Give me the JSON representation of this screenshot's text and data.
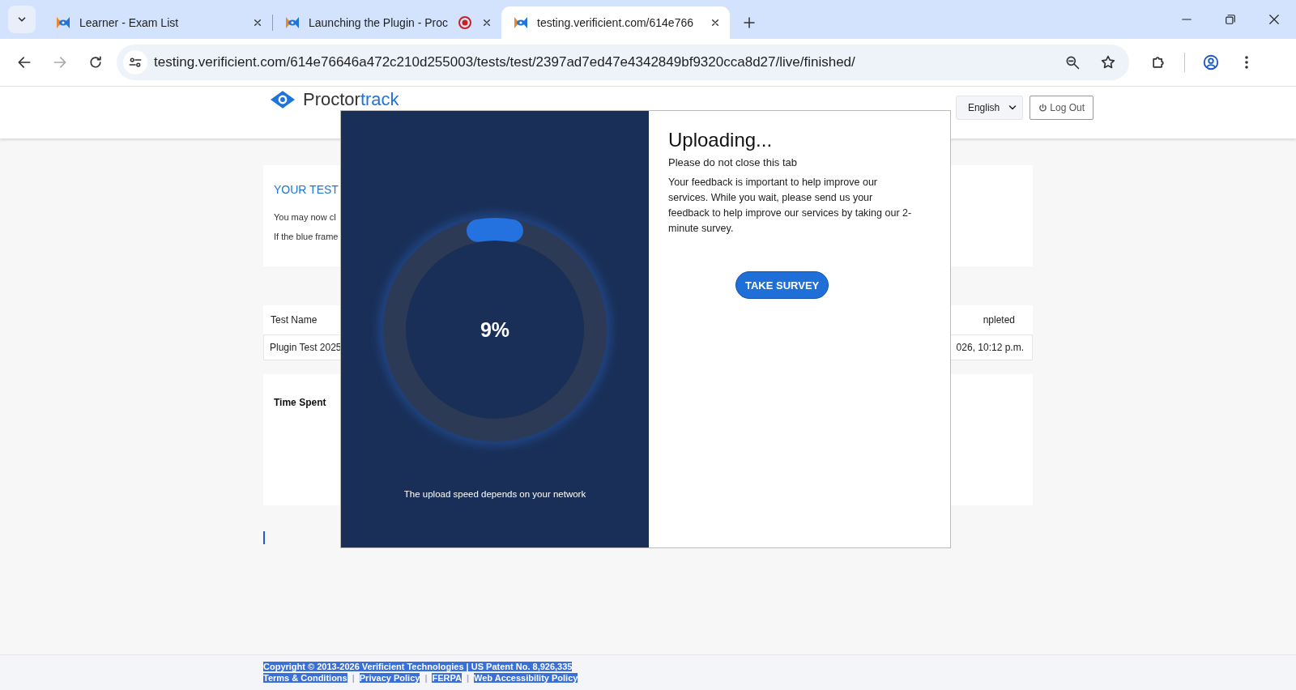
{
  "browser": {
    "tabs": [
      {
        "title": "Learner - Exam List",
        "selected": false,
        "recording": false
      },
      {
        "title": "Launching the Plugin - Proc",
        "selected": false,
        "recording": true
      },
      {
        "title": "testing.verificient.com/614e766",
        "selected": true,
        "recording": false
      }
    ],
    "url": "testing.verificient.com/614e76646a472c210d255003/tests/test/2397ad7ed47e4342849bf9320cca8d27/live/finished/"
  },
  "header": {
    "logo_parts": [
      "Proctor",
      "track"
    ],
    "language": "English",
    "logout": "Log Out"
  },
  "page": {
    "result_title": "YOUR TEST",
    "lines": [
      "You may now cl",
      "If the blue frame"
    ],
    "table": {
      "columns": [
        "Test Name",
        "npleted"
      ],
      "rows": [
        [
          "Plugin Test 2025",
          "026, 10:12 p.m."
        ]
      ]
    },
    "time_spent": "Time Spent"
  },
  "modal": {
    "level": 0.09,
    "percent": "9%",
    "note": "The upload speed depends on your network",
    "title": "Uploading...",
    "subtitle": "Please do not close this tab",
    "message": "Your feedback is important to help improve our services. While you wait, please send us your feedback to help improve our services by taking our 2-minute survey.",
    "button": "TAKE SURVEY"
  },
  "footer": {
    "copyright": "Copyright © 2013-2026 Verificient Technologies | US Patent No. 8,926,335",
    "links": [
      "Terms & Conditions",
      "Privacy Policy",
      "FERPA",
      "Web Accessibility Policy"
    ],
    "separator": "|"
  }
}
